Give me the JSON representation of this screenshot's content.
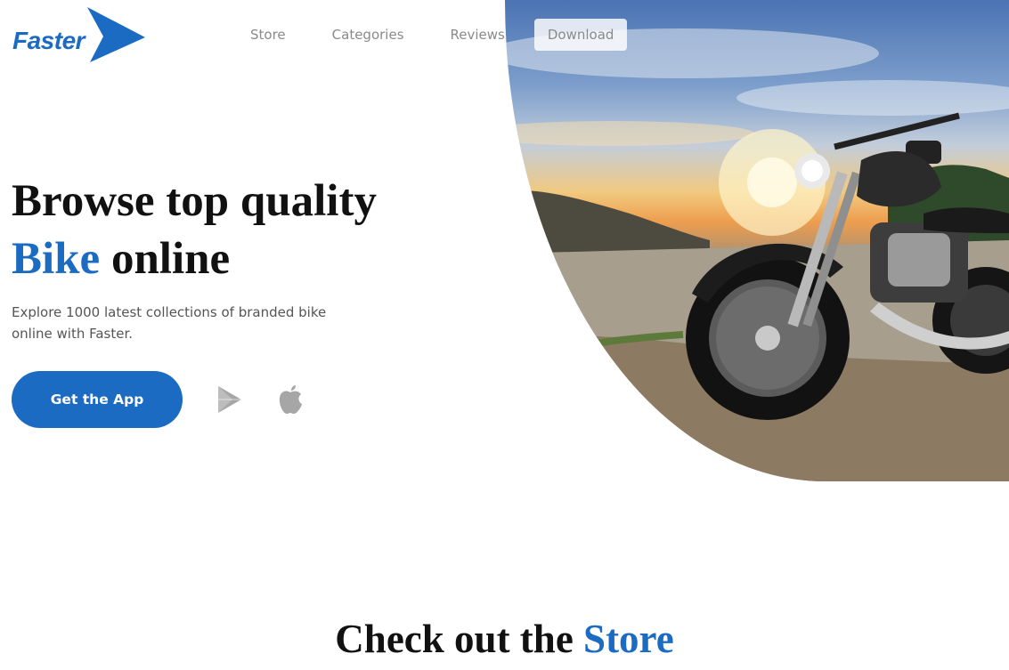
{
  "brand": {
    "name": "Faster",
    "color": "#1b6bc2"
  },
  "nav": {
    "items": [
      {
        "label": "Store"
      },
      {
        "label": "Categories"
      },
      {
        "label": "Reviews"
      },
      {
        "label": "Download"
      }
    ]
  },
  "hero": {
    "headline_line1": "Browse top quality",
    "headline_accent": "Bike",
    "headline_line2_rest": " online",
    "description": "Explore 1000 latest collections of branded bike online with Faster.",
    "cta_label": "Get the App",
    "image": "motorcycle-sunset-photo",
    "icons": [
      "google-play-icon",
      "apple-icon"
    ]
  },
  "store_section": {
    "title_prefix": "Check out the ",
    "title_accent": "Store"
  }
}
